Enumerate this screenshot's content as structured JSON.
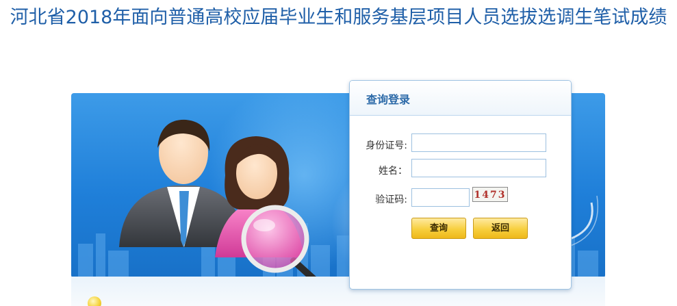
{
  "page": {
    "title": "河北省2018年面向普通高校应届毕业生和服务基层项目人员选拔选调生笔试成绩"
  },
  "login": {
    "title": "查询登录",
    "id_label": "身份证号:",
    "id_value": "",
    "name_label": "姓名：",
    "name_value": "",
    "captcha_label": "验证码:",
    "captcha_value": "",
    "captcha_text": "1473",
    "query_button": "查询",
    "back_button": "返回"
  },
  "colors": {
    "title": "#1f5fa8",
    "banner": "#1f7fd9",
    "card_title": "#2c6aa8",
    "button": "#f7cf3e"
  },
  "icons": {
    "hero": "users-search-illustration",
    "hint": "bulb-icon"
  }
}
